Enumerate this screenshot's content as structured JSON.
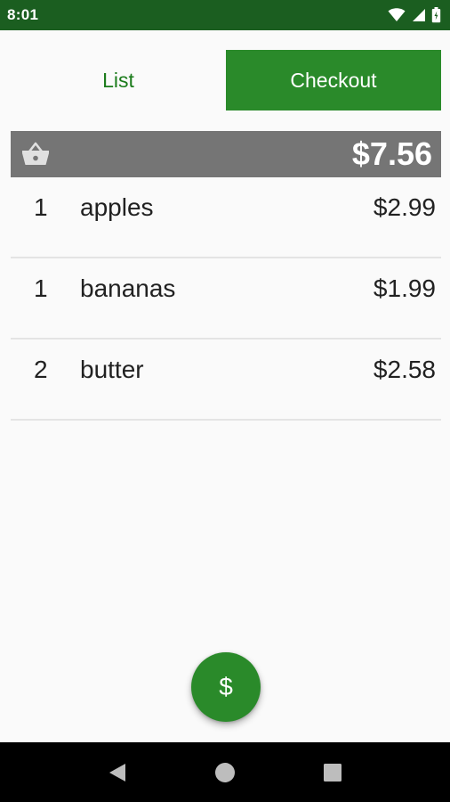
{
  "status_bar": {
    "time": "8:01",
    "icons": [
      "wifi-icon",
      "signal-icon",
      "battery-icon"
    ]
  },
  "tabs": [
    {
      "label": "List",
      "active": false
    },
    {
      "label": "Checkout",
      "active": true
    }
  ],
  "total": {
    "icon": "basket-icon",
    "amount": "$7.56"
  },
  "items": [
    {
      "qty": "1",
      "name": "apples",
      "price": "$2.99"
    },
    {
      "qty": "1",
      "name": "bananas",
      "price": "$1.99"
    },
    {
      "qty": "2",
      "name": "butter",
      "price": "$2.58"
    }
  ],
  "fab": {
    "icon": "dollar-icon",
    "label": "$"
  },
  "nav": [
    "back-icon",
    "home-icon",
    "recents-icon"
  ],
  "colors": {
    "status_bar": "#1b5e20",
    "accent": "#2a8a2a",
    "total_bar": "#757575",
    "background": "#fafafa"
  }
}
